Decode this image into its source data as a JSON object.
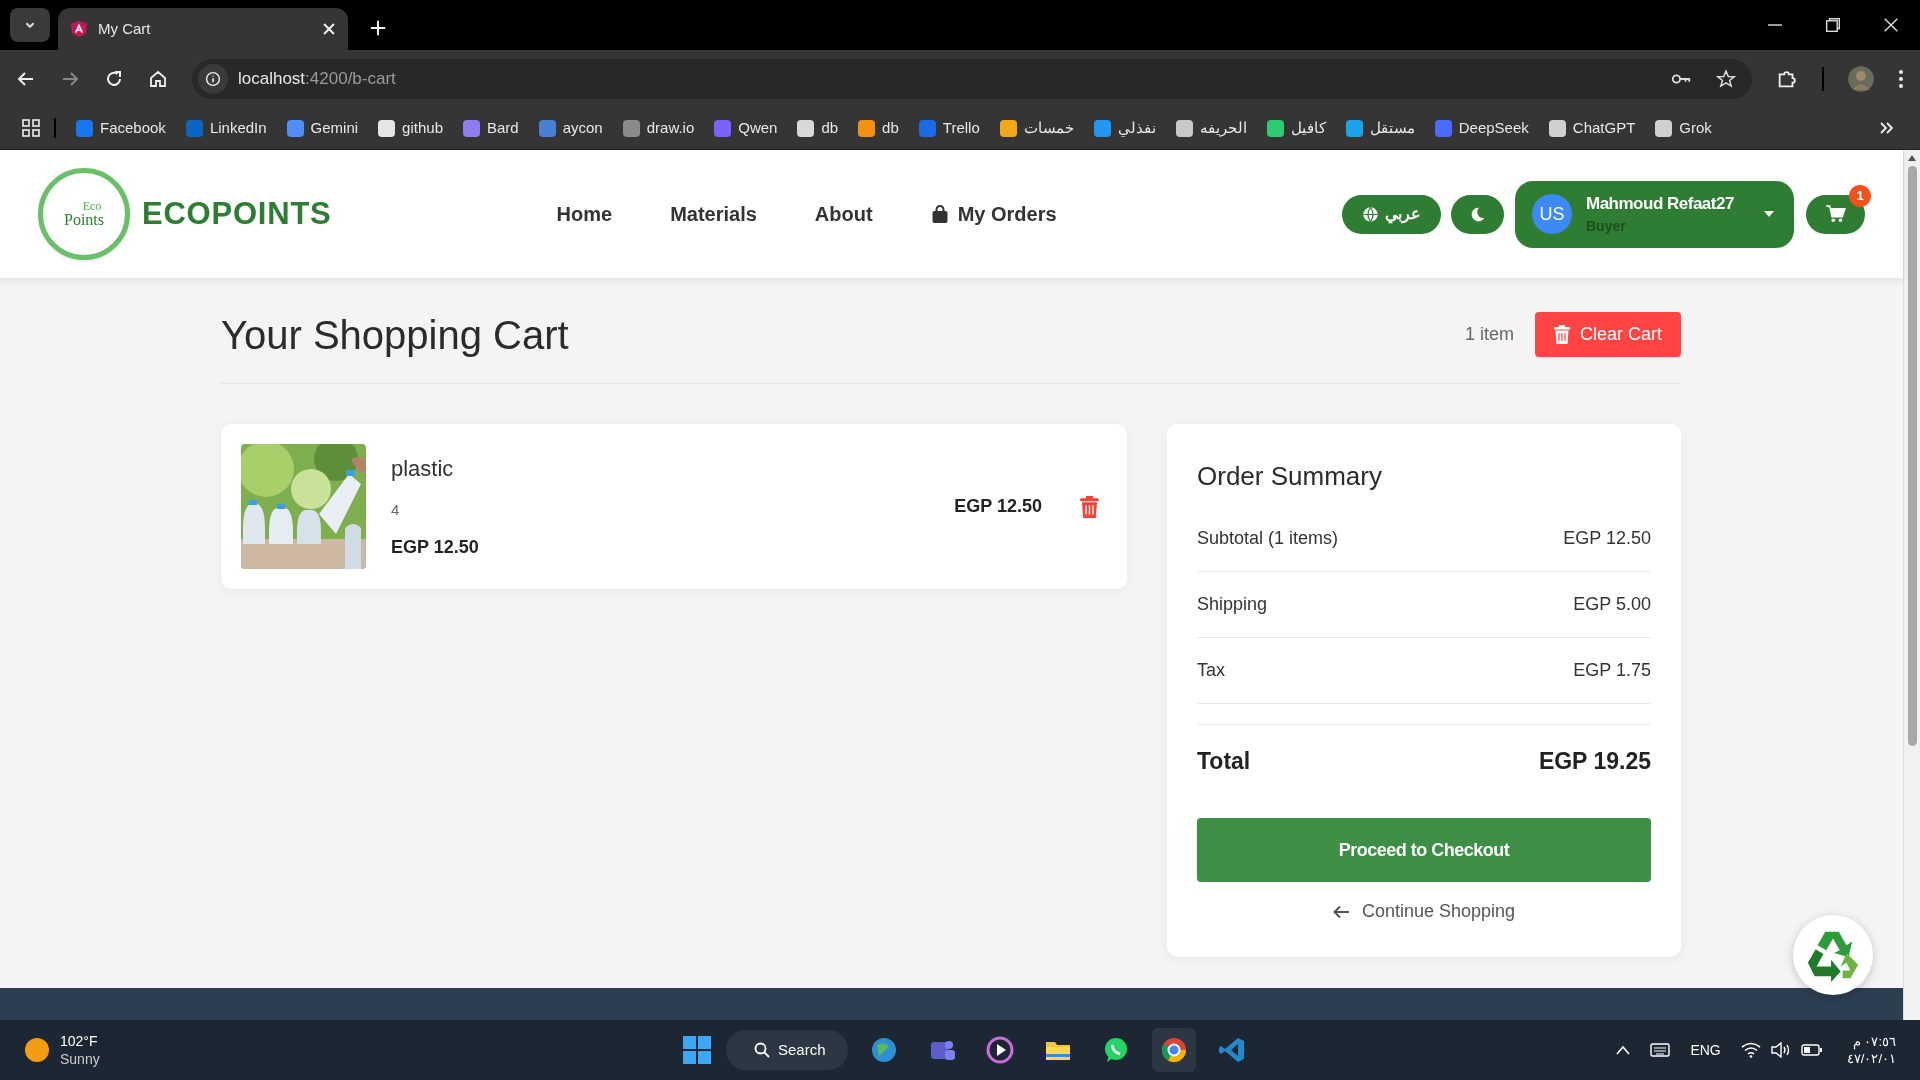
{
  "browser": {
    "tab_title": "My Cart",
    "url_host": "localhost",
    "url_path": ":4200/b-cart",
    "bookmarks": [
      {
        "label": "Facebook",
        "color": "#1877f2"
      },
      {
        "label": "LinkedIn",
        "color": "#0a66c2"
      },
      {
        "label": "Gemini",
        "color": "#4f8ff7"
      },
      {
        "label": "github",
        "color": "#e6e6e6"
      },
      {
        "label": "Bard",
        "color": "#8e7cf0"
      },
      {
        "label": "aycon",
        "color": "#4a7fd6"
      },
      {
        "label": "draw.io",
        "color": "#8a8a8a"
      },
      {
        "label": "Qwen",
        "color": "#7b61ff"
      },
      {
        "label": "db",
        "color": "#d9d9d9"
      },
      {
        "label": "db",
        "color": "#f29111"
      },
      {
        "label": "Trello",
        "color": "#1d6ae5"
      },
      {
        "label": "خمسات",
        "color": "#f2a81d"
      },
      {
        "label": "نفذلي",
        "color": "#2196f3"
      },
      {
        "label": "الحريفه",
        "color": "#c9c9c9"
      },
      {
        "label": "كافيل",
        "color": "#2ecc71"
      },
      {
        "label": "مستقل",
        "color": "#1aa3e8"
      },
      {
        "label": "DeepSeek",
        "color": "#4d6bfe"
      },
      {
        "label": "ChatGPT",
        "color": "#d0d0d0"
      },
      {
        "label": "Grok",
        "color": "#d0d0d0"
      }
    ]
  },
  "header": {
    "brand": "ECOPOINTS",
    "logo_top": "Eco",
    "logo_bottom": "Points",
    "nav": [
      {
        "label": "Home",
        "kind": "plain"
      },
      {
        "label": "Materials",
        "kind": "plain"
      },
      {
        "label": "About",
        "kind": "plain"
      },
      {
        "label": "My Orders",
        "kind": "bag"
      }
    ],
    "language": "عربي",
    "user": {
      "initials": "US",
      "name": "Mahmoud Refaat27",
      "role": "Buyer"
    },
    "cart_count": "1"
  },
  "cart": {
    "title": "Your Shopping Cart",
    "count": "1 item",
    "clear_label": "Clear Cart",
    "items": [
      {
        "name": "plastic",
        "quantity": "4",
        "unit_price": "EGP 12.50",
        "line_total": "EGP 12.50"
      }
    ]
  },
  "summary": {
    "title": "Order Summary",
    "rows": [
      {
        "label": "Subtotal (1 items)",
        "value": "EGP 12.50"
      },
      {
        "label": "Shipping",
        "value": "EGP 5.00"
      },
      {
        "label": "Tax",
        "value": "EGP 1.75"
      }
    ],
    "total_label": "Total",
    "total_value": "EGP 19.25",
    "checkout_label": "Proceed to Checkout",
    "continue_label": "Continue Shopping"
  },
  "taskbar": {
    "temperature": "102°F",
    "weather": "Sunny",
    "search": "Search",
    "language": "ENG",
    "time": "٠٧:٥٦ م",
    "date": "٤٧/٠٢/٠١"
  }
}
